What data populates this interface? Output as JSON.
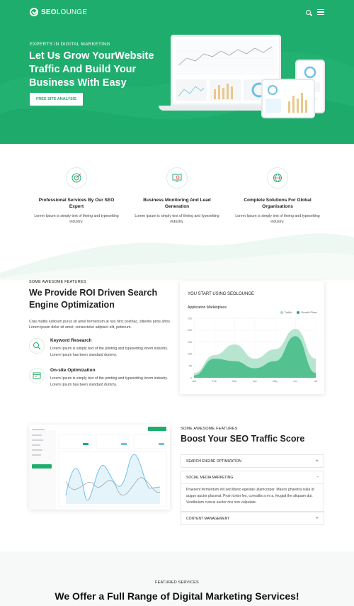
{
  "colors": {
    "brand": "#1fad6e",
    "brand_light": "#9fdcbf",
    "brand_pale": "#e9f7f0"
  },
  "nav": {
    "logo_bold": "SEO",
    "logo_light": "LOUNGE",
    "icons": [
      "search-icon",
      "menu-icon"
    ]
  },
  "hero": {
    "eyebrow": "EXPERTS IN DIGITAL MARKETING",
    "title": "Let Us Grow YourWebsite Traffic And Build Your Business With Easy",
    "button": "FREE SITE ANALYSIS"
  },
  "services": [
    {
      "title": "Professional Services By Our SEO Expert",
      "text": "Lorem Ipsum is simply text of theing and typesetting industry.",
      "icon": "target-icon"
    },
    {
      "title": "Business Monitoring And Lead Generation",
      "text": "Lorem Ipsum is simply text of theing and typesetting industry.",
      "icon": "monitor-icon"
    },
    {
      "title": "Complete Solutions For Global Organisations",
      "text": "Lorem Ipsum is simply text of theing and typesetting industry.",
      "icon": "globe-icon"
    }
  ],
  "feature1": {
    "eyebrow": "SOME AWESOME FEATURES",
    "title": "We Provide ROI Driven Search Engine Optimization",
    "text": "Cras mattis iudicium purus sit amet fermentum at nos hinc posthac, sitientis piros afros. Lorem ipsum dolor sit amet, consectetur adipisici elit, petierunt.",
    "items": [
      {
        "title": "Keyword Research",
        "text": "Lorem Ipsum is simply text of the printing and typesetting lorem industry. Lorem Ipsum has been standard dummy.",
        "icon": "keyword-icon"
      },
      {
        "title": "On-site Optimization",
        "text": "Lorem Ipsum is simply text of the printing and typesetting lorem industry. Lorem Ipsum has been standard dummy.",
        "icon": "browser-icon"
      }
    ]
  },
  "chart_card": {
    "title": "YOU START USING SEOLOUNGE",
    "subtitle": "Application Marketplace",
    "legend": [
      "Traffic",
      "Growth Plans"
    ]
  },
  "chart_data": {
    "type": "area",
    "x": [
      "Jan",
      "Feb",
      "Mar",
      "Apr",
      "May",
      "Jun",
      "Jul"
    ],
    "ylim": [
      0,
      250
    ],
    "yticks": [
      0,
      50,
      100,
      150,
      200,
      250
    ],
    "series": [
      {
        "name": "Traffic",
        "values": [
          20,
          95,
          140,
          80,
          120,
          205,
          80
        ]
      },
      {
        "name": "Growth Plans",
        "values": [
          10,
          80,
          70,
          40,
          70,
          175,
          20
        ]
      }
    ]
  },
  "feature2": {
    "eyebrow": "SOME AWESOME FEATURES",
    "title": "Boost Your SEO Traffic Score",
    "accordion": [
      {
        "label": "SEARCH ENGINE OPTIMIZATION",
        "sign": "+",
        "open": false
      },
      {
        "label": "SOCIAL MEDIA MARKETING",
        "sign": "-",
        "open": true,
        "body": "Praesent fermentum elit sed libero egestas ullamcorper. Mauris pharetra nulla id augue auctor placerat. Proin tortor leo, convallis a mi a, feugiat the aliquam dui. Vestibulum cursus auctor nisi non vulputate."
      },
      {
        "label": "CONTENT MANAGEMENT",
        "sign": "+",
        "open": false
      }
    ]
  },
  "bottom": {
    "eyebrow": "FEATURED SERVICES",
    "title": "We Offer a Full Range of Digital Marketing Services!"
  }
}
